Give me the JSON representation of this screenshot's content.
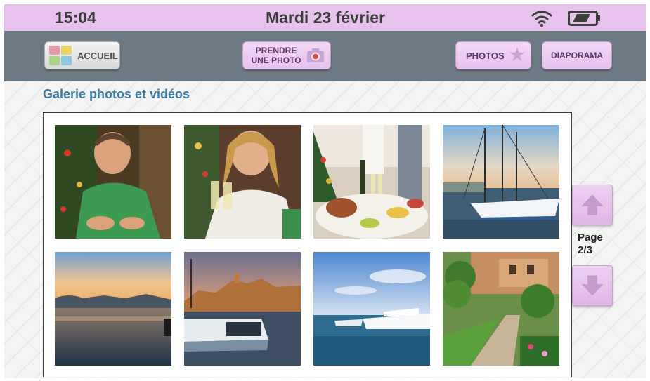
{
  "status_bar": {
    "time": "15:04",
    "date": "Mardi 23 février",
    "icons": [
      "wifi-icon",
      "battery-icon"
    ]
  },
  "toolbar": {
    "home_label": "ACCUEIL",
    "take_photo_line1": "PRENDRE",
    "take_photo_line2": "UNE PHOTO",
    "photos_label": "PHOTOS",
    "slideshow_label": "DIAPORAMA",
    "icons": [
      "home-icon",
      "camera-icon",
      "star-icon"
    ]
  },
  "gallery": {
    "title": "Galerie photos et vidéos",
    "items": [
      {
        "subject": "man-green-sweater-christmas"
      },
      {
        "subject": "woman-champagne-toast"
      },
      {
        "subject": "holiday-dinner-table"
      },
      {
        "subject": "sailboat-harbor"
      },
      {
        "subject": "harbor-sunset-town"
      },
      {
        "subject": "yachts-evening-old-town"
      },
      {
        "subject": "marina-blue-sky"
      },
      {
        "subject": "garden-palace"
      }
    ]
  },
  "pager": {
    "label_line1": "Page",
    "label_line2": "2/3"
  },
  "colors": {
    "status_bar": "#e7c2ec",
    "toolbar": "#6d7a83",
    "button": "#e6c1ec",
    "title": "#3a7ea6"
  }
}
